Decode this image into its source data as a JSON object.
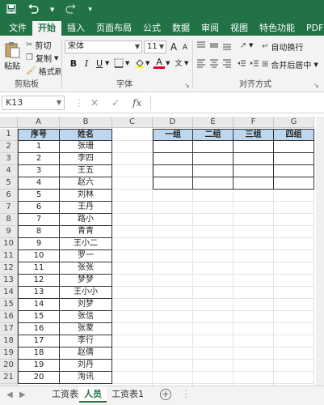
{
  "quick_access": {
    "save_icon": "save-icon",
    "undo_icon": "undo-icon",
    "redo_icon": "redo-icon",
    "customize_icon": "customize-icon"
  },
  "ribbon_tabs": [
    "文件",
    "开始",
    "插入",
    "页面布局",
    "公式",
    "数据",
    "审阅",
    "视图",
    "特色功能",
    "PDF工具集"
  ],
  "active_tab": "开始",
  "clipboard": {
    "paste": "粘贴",
    "cut": "剪切",
    "copy": "复制",
    "format_painter": "格式刷",
    "group": "剪贴板"
  },
  "font": {
    "name": "宋体",
    "size": "11",
    "group": "字体",
    "bold": "B",
    "italic": "I",
    "underline": "U",
    "grow": "A",
    "shrink": "A",
    "color_letter": "A",
    "phonetic": "wen"
  },
  "alignment": {
    "wrap": "自动换行",
    "merge": "合并后居中",
    "group": "对齐方式"
  },
  "name_box": "K13",
  "formula_icons": {
    "cancel": "✕",
    "enter": "✓",
    "fx": "fx"
  },
  "columns": [
    "A",
    "B",
    "C",
    "D",
    "E",
    "F",
    "G"
  ],
  "rows": [
    "1",
    "2",
    "3",
    "4",
    "5",
    "6",
    "7",
    "8",
    "9",
    "10",
    "11",
    "12",
    "13",
    "14",
    "15",
    "16",
    "17",
    "18",
    "19",
    "20",
    "21",
    "22",
    "23"
  ],
  "table1": {
    "headers": [
      "序号",
      "姓名"
    ],
    "rows": [
      [
        "1",
        "张珊"
      ],
      [
        "2",
        "李四"
      ],
      [
        "3",
        "王五"
      ],
      [
        "4",
        "赵六"
      ],
      [
        "5",
        "刘林"
      ],
      [
        "6",
        "王丹"
      ],
      [
        "7",
        "路小"
      ],
      [
        "8",
        "青青"
      ],
      [
        "9",
        "王小二"
      ],
      [
        "10",
        "罗一"
      ],
      [
        "11",
        "张张"
      ],
      [
        "12",
        "梦梦"
      ],
      [
        "13",
        "王小小"
      ],
      [
        "14",
        "刘梦"
      ],
      [
        "15",
        "张信"
      ],
      [
        "16",
        "张蒙"
      ],
      [
        "17",
        "李行"
      ],
      [
        "18",
        "赵倩"
      ],
      [
        "19",
        "刘丹"
      ],
      [
        "20",
        "洵讯"
      ]
    ]
  },
  "table2": {
    "headers": [
      "一组",
      "二组",
      "三组",
      "四组"
    ],
    "empty_rows": 4
  },
  "sheets": [
    "工资表",
    "人员",
    "工资表1"
  ],
  "active_sheet": "人员",
  "add_sheet": "+",
  "colors": {
    "brand": "#217346",
    "header_fill": "#bdd7ee"
  }
}
